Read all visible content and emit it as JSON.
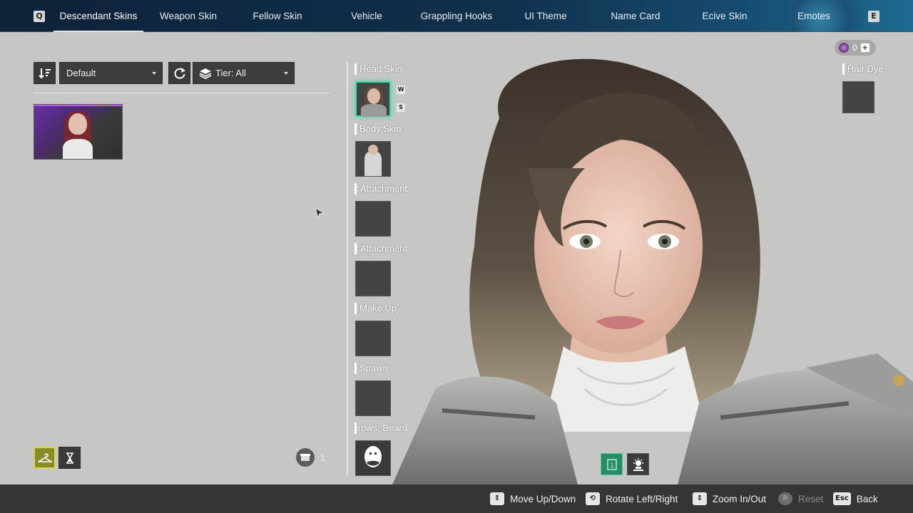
{
  "top_tabs": {
    "left_key": "Q",
    "right_key": "E",
    "items": [
      {
        "label": "Descendant Skins",
        "active": true
      },
      {
        "label": "Weapon Skin"
      },
      {
        "label": "Fellow Skin"
      },
      {
        "label": "Vehicle"
      },
      {
        "label": "Grappling Hooks"
      },
      {
        "label": "UI Theme"
      },
      {
        "label": "Name Card"
      },
      {
        "label": "Ecive Skin"
      },
      {
        "label": "Emotes"
      }
    ]
  },
  "filters": {
    "sort_value": "Default",
    "tier_value": "Tier: All"
  },
  "skins_list": [
    {
      "name": "skin-card-1",
      "rarity_color": "#b45cf0"
    }
  ],
  "bottom_left": {
    "box_count": "1"
  },
  "slots": {
    "head_skin": "Head Skin",
    "body_skin": "Body Skin",
    "back_attachment": "Back Attachment",
    "chest_attachment": "Chest Attachment",
    "make_up": "Make Up",
    "spawn": "Spawn",
    "eyebrows_beard": "Eyebrows, Beard",
    "head_keys": [
      "W",
      "S"
    ]
  },
  "right_panel": {
    "currency_value": "0",
    "hair_dye_label": "Hair Dye",
    "view_button_value": "1"
  },
  "bottom_hints": [
    {
      "key": "⇕",
      "label": "Move Up/Down"
    },
    {
      "key": "⟲",
      "label": "Rotate Left/Right"
    },
    {
      "key": "⇕",
      "label": "Zoom In/Out"
    },
    {
      "key": "R",
      "label": "Reset",
      "disabled": true
    },
    {
      "key": "Esc",
      "label": "Back"
    }
  ],
  "colors": {
    "topbar": "#10304c",
    "accent_green": "#3de0a8",
    "selected_filter": "#d8d84a",
    "rarity_purple": "#b45cf0"
  }
}
